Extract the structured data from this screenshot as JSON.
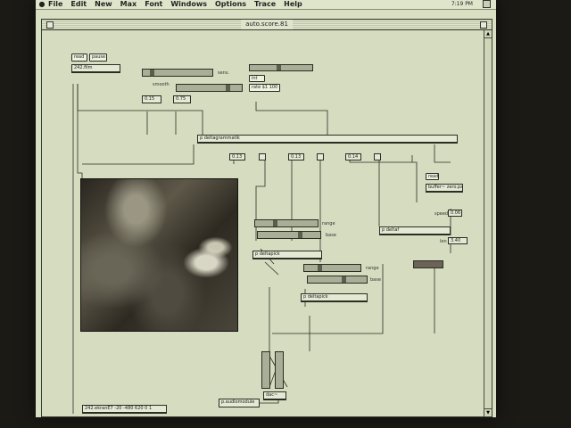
{
  "menubar": {
    "items": [
      "File",
      "Edit",
      "New",
      "Max",
      "Font",
      "Windows",
      "Options",
      "Trace",
      "Help"
    ],
    "clock": "7:19 PM"
  },
  "window": {
    "title": "auto.score.81"
  },
  "patch": {
    "msg_read": "read",
    "msg_pause": "pause",
    "movie_obj": "242.film",
    "label_sens": "sens.",
    "label_smooth": "smooth",
    "num_a": "0.15",
    "num_b": "0.75",
    "msg_int": "int",
    "msg_rate": "rate $1 100",
    "diagram_obj": "p deltagrammatik",
    "out_nums": [
      "0.13",
      "0.13",
      "0.14"
    ],
    "label_range1": "range",
    "label_base1": "base",
    "deltapick1": "p deltapick",
    "label_range2": "range",
    "label_base2": "base",
    "deltapick2": "p deltapick",
    "deltaf": "p deltaf",
    "msg_read2": "read",
    "buffer_obj": "buffer~ zero.pand",
    "label_speed": "speed",
    "speed_val": "0.06",
    "label_len": "len",
    "len_val": "3.40",
    "dac_obj": "dac~",
    "bottom_obj": "p.audiomodule",
    "screen_obj": "242.ekranE7 -20 -480 620 0 1"
  }
}
